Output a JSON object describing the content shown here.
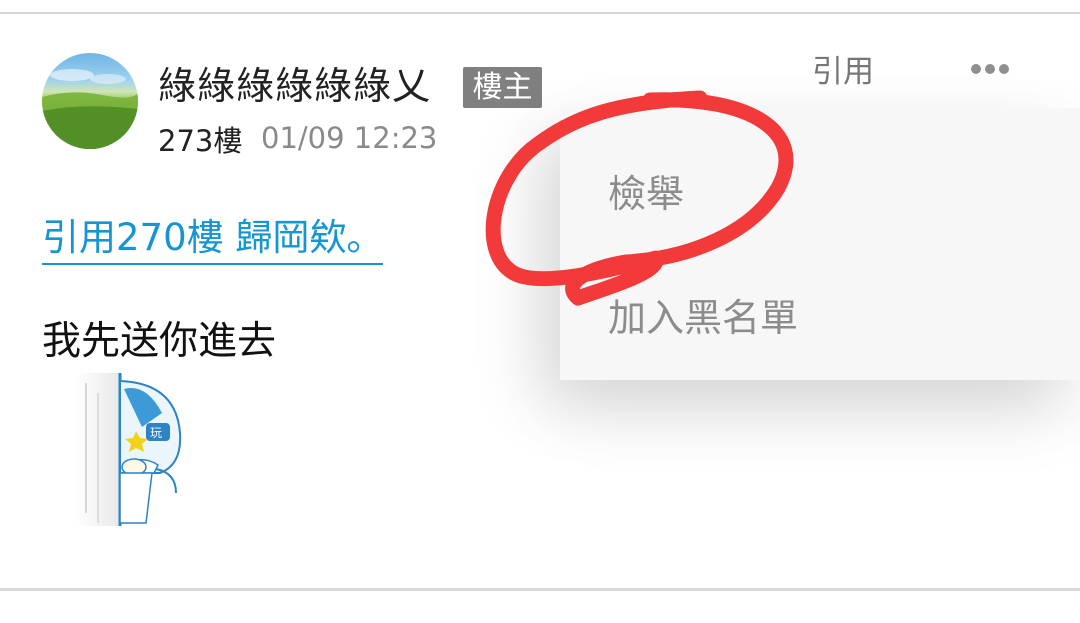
{
  "post": {
    "username": "綠綠綠綠綠綠乂",
    "host_badge": "樓主",
    "floor": "273樓",
    "timestamp": "01/09 12:23",
    "quote_link": "引用270樓 歸岡欸。",
    "body_text": "我先送你進去",
    "sticker": "peeking-character-sticker"
  },
  "actions": {
    "quote_label": "引用",
    "more_icon": "more-horizontal-icon"
  },
  "menu": {
    "items": [
      {
        "label": "檢舉"
      },
      {
        "label": "加入黑名單"
      }
    ]
  },
  "colors": {
    "link": "#1595d2",
    "badge_bg": "#808080",
    "annotation": "#f23a3a",
    "menu_bg": "#f7f7f7"
  }
}
